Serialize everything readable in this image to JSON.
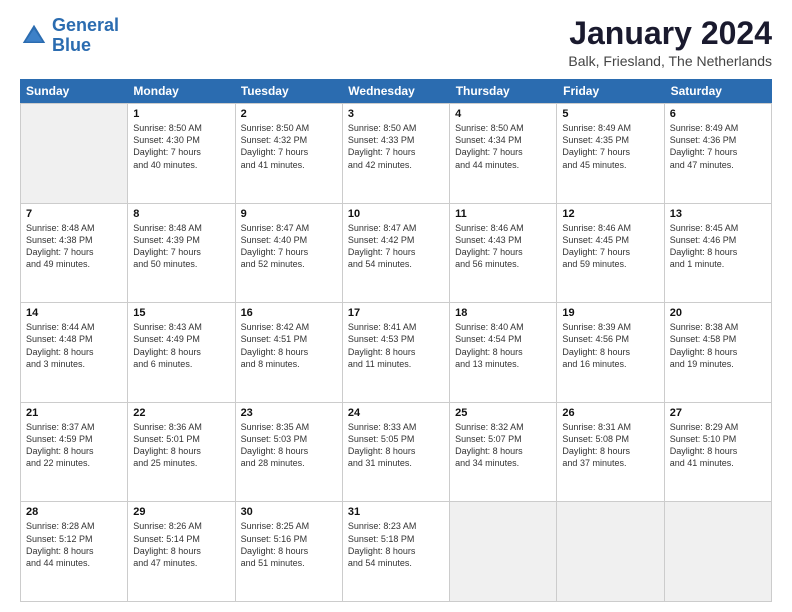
{
  "logo": {
    "line1": "General",
    "line2": "Blue"
  },
  "title": "January 2024",
  "location": "Balk, Friesland, The Netherlands",
  "days_of_week": [
    "Sunday",
    "Monday",
    "Tuesday",
    "Wednesday",
    "Thursday",
    "Friday",
    "Saturday"
  ],
  "weeks": [
    [
      {
        "day": "",
        "sunrise": "",
        "sunset": "",
        "daylight": "",
        "empty": true
      },
      {
        "day": "1",
        "sunrise": "Sunrise: 8:50 AM",
        "sunset": "Sunset: 4:30 PM",
        "daylight": "Daylight: 7 hours and 40 minutes."
      },
      {
        "day": "2",
        "sunrise": "Sunrise: 8:50 AM",
        "sunset": "Sunset: 4:32 PM",
        "daylight": "Daylight: 7 hours and 41 minutes."
      },
      {
        "day": "3",
        "sunrise": "Sunrise: 8:50 AM",
        "sunset": "Sunset: 4:33 PM",
        "daylight": "Daylight: 7 hours and 42 minutes."
      },
      {
        "day": "4",
        "sunrise": "Sunrise: 8:50 AM",
        "sunset": "Sunset: 4:34 PM",
        "daylight": "Daylight: 7 hours and 44 minutes."
      },
      {
        "day": "5",
        "sunrise": "Sunrise: 8:49 AM",
        "sunset": "Sunset: 4:35 PM",
        "daylight": "Daylight: 7 hours and 45 minutes."
      },
      {
        "day": "6",
        "sunrise": "Sunrise: 8:49 AM",
        "sunset": "Sunset: 4:36 PM",
        "daylight": "Daylight: 7 hours and 47 minutes."
      }
    ],
    [
      {
        "day": "7",
        "sunrise": "Sunrise: 8:48 AM",
        "sunset": "Sunset: 4:38 PM",
        "daylight": "Daylight: 7 hours and 49 minutes."
      },
      {
        "day": "8",
        "sunrise": "Sunrise: 8:48 AM",
        "sunset": "Sunset: 4:39 PM",
        "daylight": "Daylight: 7 hours and 50 minutes."
      },
      {
        "day": "9",
        "sunrise": "Sunrise: 8:47 AM",
        "sunset": "Sunset: 4:40 PM",
        "daylight": "Daylight: 7 hours and 52 minutes."
      },
      {
        "day": "10",
        "sunrise": "Sunrise: 8:47 AM",
        "sunset": "Sunset: 4:42 PM",
        "daylight": "Daylight: 7 hours and 54 minutes."
      },
      {
        "day": "11",
        "sunrise": "Sunrise: 8:46 AM",
        "sunset": "Sunset: 4:43 PM",
        "daylight": "Daylight: 7 hours and 56 minutes."
      },
      {
        "day": "12",
        "sunrise": "Sunrise: 8:46 AM",
        "sunset": "Sunset: 4:45 PM",
        "daylight": "Daylight: 7 hours and 59 minutes."
      },
      {
        "day": "13",
        "sunrise": "Sunrise: 8:45 AM",
        "sunset": "Sunset: 4:46 PM",
        "daylight": "Daylight: 8 hours and 1 minute."
      }
    ],
    [
      {
        "day": "14",
        "sunrise": "Sunrise: 8:44 AM",
        "sunset": "Sunset: 4:48 PM",
        "daylight": "Daylight: 8 hours and 3 minutes."
      },
      {
        "day": "15",
        "sunrise": "Sunrise: 8:43 AM",
        "sunset": "Sunset: 4:49 PM",
        "daylight": "Daylight: 8 hours and 6 minutes."
      },
      {
        "day": "16",
        "sunrise": "Sunrise: 8:42 AM",
        "sunset": "Sunset: 4:51 PM",
        "daylight": "Daylight: 8 hours and 8 minutes."
      },
      {
        "day": "17",
        "sunrise": "Sunrise: 8:41 AM",
        "sunset": "Sunset: 4:53 PM",
        "daylight": "Daylight: 8 hours and 11 minutes."
      },
      {
        "day": "18",
        "sunrise": "Sunrise: 8:40 AM",
        "sunset": "Sunset: 4:54 PM",
        "daylight": "Daylight: 8 hours and 13 minutes."
      },
      {
        "day": "19",
        "sunrise": "Sunrise: 8:39 AM",
        "sunset": "Sunset: 4:56 PM",
        "daylight": "Daylight: 8 hours and 16 minutes."
      },
      {
        "day": "20",
        "sunrise": "Sunrise: 8:38 AM",
        "sunset": "Sunset: 4:58 PM",
        "daylight": "Daylight: 8 hours and 19 minutes."
      }
    ],
    [
      {
        "day": "21",
        "sunrise": "Sunrise: 8:37 AM",
        "sunset": "Sunset: 4:59 PM",
        "daylight": "Daylight: 8 hours and 22 minutes."
      },
      {
        "day": "22",
        "sunrise": "Sunrise: 8:36 AM",
        "sunset": "Sunset: 5:01 PM",
        "daylight": "Daylight: 8 hours and 25 minutes."
      },
      {
        "day": "23",
        "sunrise": "Sunrise: 8:35 AM",
        "sunset": "Sunset: 5:03 PM",
        "daylight": "Daylight: 8 hours and 28 minutes."
      },
      {
        "day": "24",
        "sunrise": "Sunrise: 8:33 AM",
        "sunset": "Sunset: 5:05 PM",
        "daylight": "Daylight: 8 hours and 31 minutes."
      },
      {
        "day": "25",
        "sunrise": "Sunrise: 8:32 AM",
        "sunset": "Sunset: 5:07 PM",
        "daylight": "Daylight: 8 hours and 34 minutes."
      },
      {
        "day": "26",
        "sunrise": "Sunrise: 8:31 AM",
        "sunset": "Sunset: 5:08 PM",
        "daylight": "Daylight: 8 hours and 37 minutes."
      },
      {
        "day": "27",
        "sunrise": "Sunrise: 8:29 AM",
        "sunset": "Sunset: 5:10 PM",
        "daylight": "Daylight: 8 hours and 41 minutes."
      }
    ],
    [
      {
        "day": "28",
        "sunrise": "Sunrise: 8:28 AM",
        "sunset": "Sunset: 5:12 PM",
        "daylight": "Daylight: 8 hours and 44 minutes."
      },
      {
        "day": "29",
        "sunrise": "Sunrise: 8:26 AM",
        "sunset": "Sunset: 5:14 PM",
        "daylight": "Daylight: 8 hours and 47 minutes."
      },
      {
        "day": "30",
        "sunrise": "Sunrise: 8:25 AM",
        "sunset": "Sunset: 5:16 PM",
        "daylight": "Daylight: 8 hours and 51 minutes."
      },
      {
        "day": "31",
        "sunrise": "Sunrise: 8:23 AM",
        "sunset": "Sunset: 5:18 PM",
        "daylight": "Daylight: 8 hours and 54 minutes."
      },
      {
        "day": "",
        "sunrise": "",
        "sunset": "",
        "daylight": "",
        "empty": true
      },
      {
        "day": "",
        "sunrise": "",
        "sunset": "",
        "daylight": "",
        "empty": true
      },
      {
        "day": "",
        "sunrise": "",
        "sunset": "",
        "daylight": "",
        "empty": true
      }
    ]
  ]
}
